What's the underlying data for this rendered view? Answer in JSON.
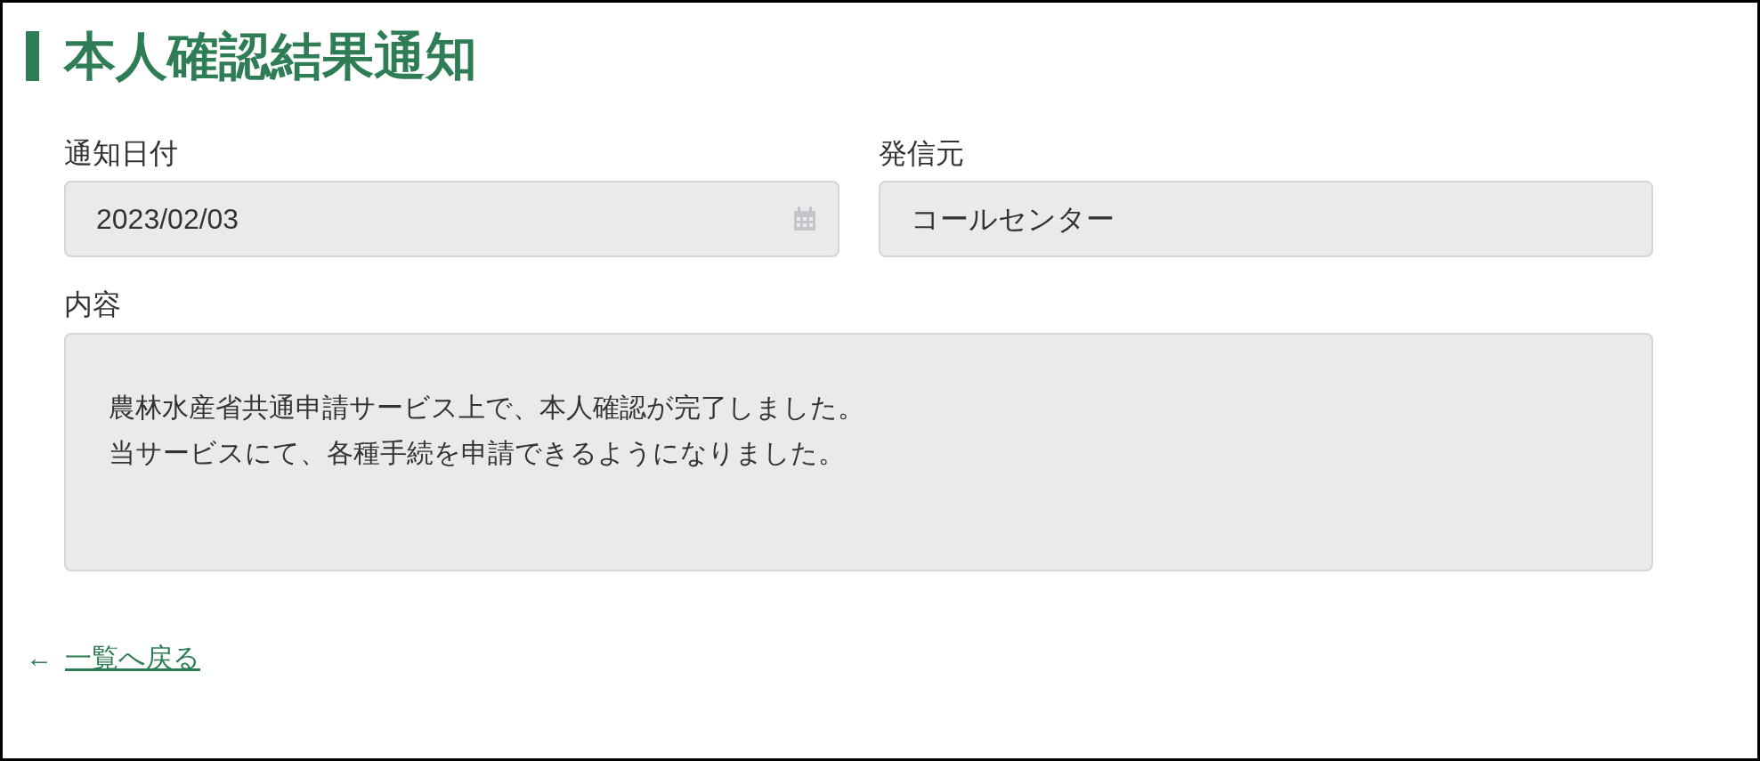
{
  "title": "本人確認結果通知",
  "fields": [
    {
      "label": "通知日付",
      "value": "2023/02/03",
      "kind": "date"
    },
    {
      "label": "発信元",
      "value": "コールセンター",
      "kind": "text"
    }
  ],
  "content": {
    "label": "内容",
    "lines": [
      "農林水産省共通申請サービス上で、本人確認が完了しました。",
      "当サービスにて、各種手続を申請できるようになりました。"
    ]
  },
  "back_link": {
    "arrow": "←",
    "label": "一覧へ戻る"
  }
}
